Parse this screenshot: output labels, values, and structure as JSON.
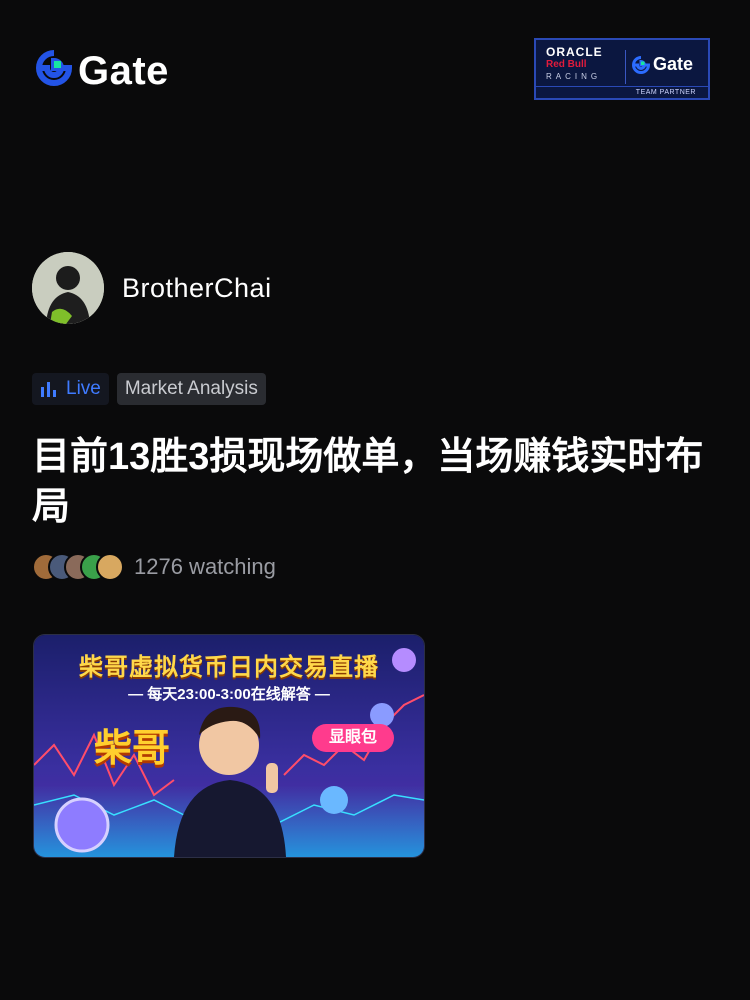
{
  "header": {
    "logo_text": "Gate",
    "partner_badge": {
      "oracle": "ORACLE",
      "redbull": "Red Bull",
      "racing": "RACING",
      "gate": "Gate",
      "tagline": "TEAM PARTNER"
    }
  },
  "author": {
    "name": "BrotherChai"
  },
  "tags": {
    "live_label": "Live",
    "category_label": "Market Analysis"
  },
  "post": {
    "title": "目前13胜3损现场做单，当场赚钱实时布局"
  },
  "viewers": {
    "watching_text": "1276 watching"
  },
  "banner": {
    "title": "柴哥虚拟货币日内交易直播",
    "subtitle": "— 每天23:00-3:00在线解答 —",
    "name": "柴哥",
    "badge": "显眼包"
  },
  "colors": {
    "background": "#0a0a0b",
    "live_blue": "#3f7bff",
    "brand_cyan": "#17e6a1"
  }
}
